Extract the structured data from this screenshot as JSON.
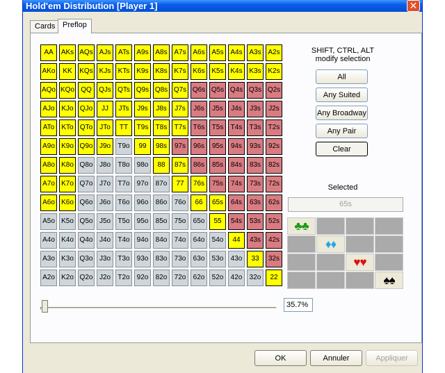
{
  "window": {
    "title": "Hold'em Distribution [Player 1]",
    "close_glyph": "✕"
  },
  "tabs": [
    {
      "label": "Cards",
      "active": false
    },
    {
      "label": "Preflop",
      "active": true
    }
  ],
  "range_grid": [
    [
      [
        "AA",
        "y"
      ],
      [
        "AKs",
        "y"
      ],
      [
        "AQs",
        "y"
      ],
      [
        "AJs",
        "y"
      ],
      [
        "ATs",
        "y"
      ],
      [
        "A9s",
        "y"
      ],
      [
        "A8s",
        "y"
      ],
      [
        "A7s",
        "y"
      ],
      [
        "A6s",
        "y"
      ],
      [
        "A5s",
        "y"
      ],
      [
        "A4s",
        "y"
      ],
      [
        "A3s",
        "y"
      ],
      [
        "A2s",
        "y"
      ]
    ],
    [
      [
        "AKo",
        "y"
      ],
      [
        "KK",
        "y"
      ],
      [
        "KQs",
        "y"
      ],
      [
        "KJs",
        "y"
      ],
      [
        "KTs",
        "y"
      ],
      [
        "K9s",
        "y"
      ],
      [
        "K8s",
        "y"
      ],
      [
        "K7s",
        "y"
      ],
      [
        "K6s",
        "y"
      ],
      [
        "K5s",
        "y"
      ],
      [
        "K4s",
        "y"
      ],
      [
        "K3s",
        "y"
      ],
      [
        "K2s",
        "y"
      ]
    ],
    [
      [
        "AQo",
        "y"
      ],
      [
        "KQo",
        "y"
      ],
      [
        "QQ",
        "y"
      ],
      [
        "QJs",
        "y"
      ],
      [
        "QTs",
        "y"
      ],
      [
        "Q9s",
        "y"
      ],
      [
        "Q8s",
        "y"
      ],
      [
        "Q7s",
        "y"
      ],
      [
        "Q6s",
        "p"
      ],
      [
        "Q5s",
        "p"
      ],
      [
        "Q4s",
        "p"
      ],
      [
        "Q3s",
        "p"
      ],
      [
        "Q2s",
        "p"
      ]
    ],
    [
      [
        "AJo",
        "y"
      ],
      [
        "KJo",
        "y"
      ],
      [
        "QJo",
        "y"
      ],
      [
        "JJ",
        "y"
      ],
      [
        "JTs",
        "y"
      ],
      [
        "J9s",
        "y"
      ],
      [
        "J8s",
        "y"
      ],
      [
        "J7s",
        "y"
      ],
      [
        "J6s",
        "p"
      ],
      [
        "J5s",
        "p"
      ],
      [
        "J4s",
        "p"
      ],
      [
        "J3s",
        "p"
      ],
      [
        "J2s",
        "p"
      ]
    ],
    [
      [
        "ATo",
        "y"
      ],
      [
        "KTo",
        "y"
      ],
      [
        "QTo",
        "y"
      ],
      [
        "JTo",
        "y"
      ],
      [
        "TT",
        "y"
      ],
      [
        "T9s",
        "y"
      ],
      [
        "T8s",
        "y"
      ],
      [
        "T7s",
        "y"
      ],
      [
        "T6s",
        "p"
      ],
      [
        "T5s",
        "p"
      ],
      [
        "T4s",
        "p"
      ],
      [
        "T3s",
        "p"
      ],
      [
        "T2s",
        "p"
      ]
    ],
    [
      [
        "A9o",
        "y"
      ],
      [
        "K9o",
        "y"
      ],
      [
        "Q9o",
        "y"
      ],
      [
        "J9o",
        "y"
      ],
      [
        "T9o",
        "g"
      ],
      [
        "99",
        "y"
      ],
      [
        "98s",
        "y"
      ],
      [
        "97s",
        "p"
      ],
      [
        "96s",
        "p"
      ],
      [
        "95s",
        "p"
      ],
      [
        "94s",
        "p"
      ],
      [
        "93s",
        "p"
      ],
      [
        "92s",
        "p"
      ]
    ],
    [
      [
        "A8o",
        "y"
      ],
      [
        "K8o",
        "y"
      ],
      [
        "Q8o",
        "g"
      ],
      [
        "J8o",
        "g"
      ],
      [
        "T8o",
        "g"
      ],
      [
        "98o",
        "g"
      ],
      [
        "88",
        "y"
      ],
      [
        "87s",
        "y"
      ],
      [
        "86s",
        "p"
      ],
      [
        "85s",
        "p"
      ],
      [
        "84s",
        "p"
      ],
      [
        "83s",
        "p"
      ],
      [
        "82s",
        "p"
      ]
    ],
    [
      [
        "A7o",
        "y"
      ],
      [
        "K7o",
        "y"
      ],
      [
        "Q7o",
        "g"
      ],
      [
        "J7o",
        "g"
      ],
      [
        "T7o",
        "g"
      ],
      [
        "97o",
        "g"
      ],
      [
        "87o",
        "g"
      ],
      [
        "77",
        "y"
      ],
      [
        "76s",
        "y"
      ],
      [
        "75s",
        "p"
      ],
      [
        "74s",
        "p"
      ],
      [
        "73s",
        "p"
      ],
      [
        "72s",
        "p"
      ]
    ],
    [
      [
        "A6o",
        "y"
      ],
      [
        "K6o",
        "y"
      ],
      [
        "Q6o",
        "g"
      ],
      [
        "J6o",
        "g"
      ],
      [
        "T6o",
        "g"
      ],
      [
        "96o",
        "g"
      ],
      [
        "86o",
        "g"
      ],
      [
        "76o",
        "g"
      ],
      [
        "66",
        "y"
      ],
      [
        "65s",
        "y"
      ],
      [
        "64s",
        "p"
      ],
      [
        "63s",
        "p"
      ],
      [
        "62s",
        "p"
      ]
    ],
    [
      [
        "A5o",
        "g"
      ],
      [
        "K5o",
        "g"
      ],
      [
        "Q5o",
        "g"
      ],
      [
        "J5o",
        "g"
      ],
      [
        "T5o",
        "g"
      ],
      [
        "95o",
        "g"
      ],
      [
        "85o",
        "g"
      ],
      [
        "75o",
        "g"
      ],
      [
        "65o",
        "g"
      ],
      [
        "55",
        "y"
      ],
      [
        "54s",
        "p"
      ],
      [
        "53s",
        "p"
      ],
      [
        "52s",
        "p"
      ]
    ],
    [
      [
        "A4o",
        "g"
      ],
      [
        "K4o",
        "g"
      ],
      [
        "Q4o",
        "g"
      ],
      [
        "J4o",
        "g"
      ],
      [
        "T4o",
        "g"
      ],
      [
        "94o",
        "g"
      ],
      [
        "84o",
        "g"
      ],
      [
        "74o",
        "g"
      ],
      [
        "64o",
        "g"
      ],
      [
        "54o",
        "g"
      ],
      [
        "44",
        "y"
      ],
      [
        "43s",
        "p"
      ],
      [
        "42s",
        "p"
      ]
    ],
    [
      [
        "A3o",
        "g"
      ],
      [
        "K3o",
        "g"
      ],
      [
        "Q3o",
        "g"
      ],
      [
        "J3o",
        "g"
      ],
      [
        "T3o",
        "g"
      ],
      [
        "93o",
        "g"
      ],
      [
        "83o",
        "g"
      ],
      [
        "73o",
        "g"
      ],
      [
        "63o",
        "g"
      ],
      [
        "53o",
        "g"
      ],
      [
        "43o",
        "g"
      ],
      [
        "33",
        "y"
      ],
      [
        "32s",
        "p"
      ]
    ],
    [
      [
        "A2o",
        "g"
      ],
      [
        "K2o",
        "g"
      ],
      [
        "Q2o",
        "g"
      ],
      [
        "J2o",
        "g"
      ],
      [
        "T2o",
        "g"
      ],
      [
        "92o",
        "g"
      ],
      [
        "82o",
        "g"
      ],
      [
        "72o",
        "g"
      ],
      [
        "62o",
        "g"
      ],
      [
        "52o",
        "g"
      ],
      [
        "42o",
        "g"
      ],
      [
        "32o",
        "g"
      ],
      [
        "22",
        "y"
      ]
    ]
  ],
  "cell_colors": {
    "y": "#ffff00",
    "p": "#d97c82",
    "g": "#ced6dc"
  },
  "modify": {
    "line1": "SHIFT, CTRL, ALT",
    "line2": "modify selection",
    "buttons": [
      "All",
      "Any Suited",
      "Any Broadway",
      "Any Pair",
      "Clear"
    ]
  },
  "selected": {
    "label": "Selected",
    "value": "65s"
  },
  "suits": [
    {
      "name": "clubs",
      "glyph": "♣♣",
      "color": "#1a9a1a"
    },
    {
      "name": "diamonds",
      "glyph": "♦♦",
      "color": "#22a8e8"
    },
    {
      "name": "hearts",
      "glyph": "♥♥",
      "color": "#e01010"
    },
    {
      "name": "spades",
      "glyph": "♠♠",
      "color": "#000000"
    }
  ],
  "slider": {
    "percent_label": "35.7%",
    "percent": 35.7
  },
  "footer": {
    "ok": "OK",
    "cancel": "Annuler",
    "apply": "Appliquer"
  }
}
